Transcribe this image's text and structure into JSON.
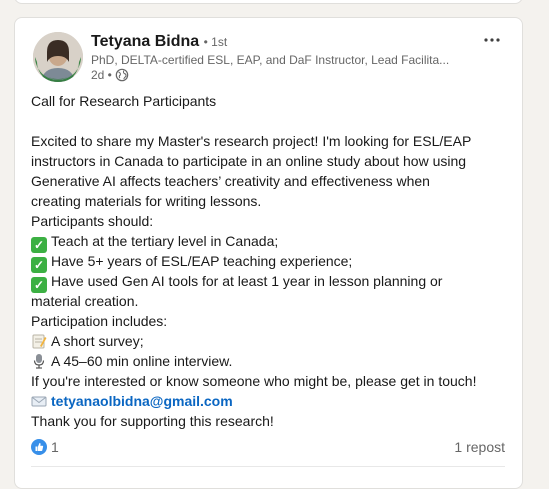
{
  "post": {
    "author_name": "Tetyana Bidna",
    "connection_degree": "• 1st",
    "headline": "PhD, DELTA-certified ESL, EAP, and DaF Instructor, Lead Facilita...",
    "time": "2d •",
    "visibility_icon": "globe-icon",
    "avatar_badge": "#OPENTOWORK",
    "text": {
      "title": "Call for Research Participants",
      "intro_1": "Excited to share my Master's research project! I'm looking for ESL/EAP",
      "intro_2": "instructors in Canada to participate in an online study about how using",
      "intro_3": "Generative AI affects teachers’ creativity and effectiveness when",
      "intro_4": "creating materials for writing lessons.",
      "participants_heading": "Participants should:",
      "req_1": "Teach at the tertiary level in Canada;",
      "req_2": "Have 5+ years of ESL/EAP teaching experience;",
      "req_3a": "Have used Gen AI tools for at least 1 year in lesson planning or",
      "req_3b": "material creation.",
      "includes_heading": "Participation includes:",
      "inc_1": "A short survey;",
      "inc_2": "A 45–60 min online interview.",
      "contact": "If you're interested or know someone who might be, please get in touch!",
      "email": "tetyanaolbidna@gmail.com",
      "thanks": "Thank you for supporting this research!"
    },
    "reactions_count": "1",
    "reposts": "1 repost"
  },
  "colors": {
    "link": "#0a66c2",
    "check_green": "#3cb043",
    "like_blue": "#378fe9",
    "open_to_work_green": "#2f7d3a"
  }
}
